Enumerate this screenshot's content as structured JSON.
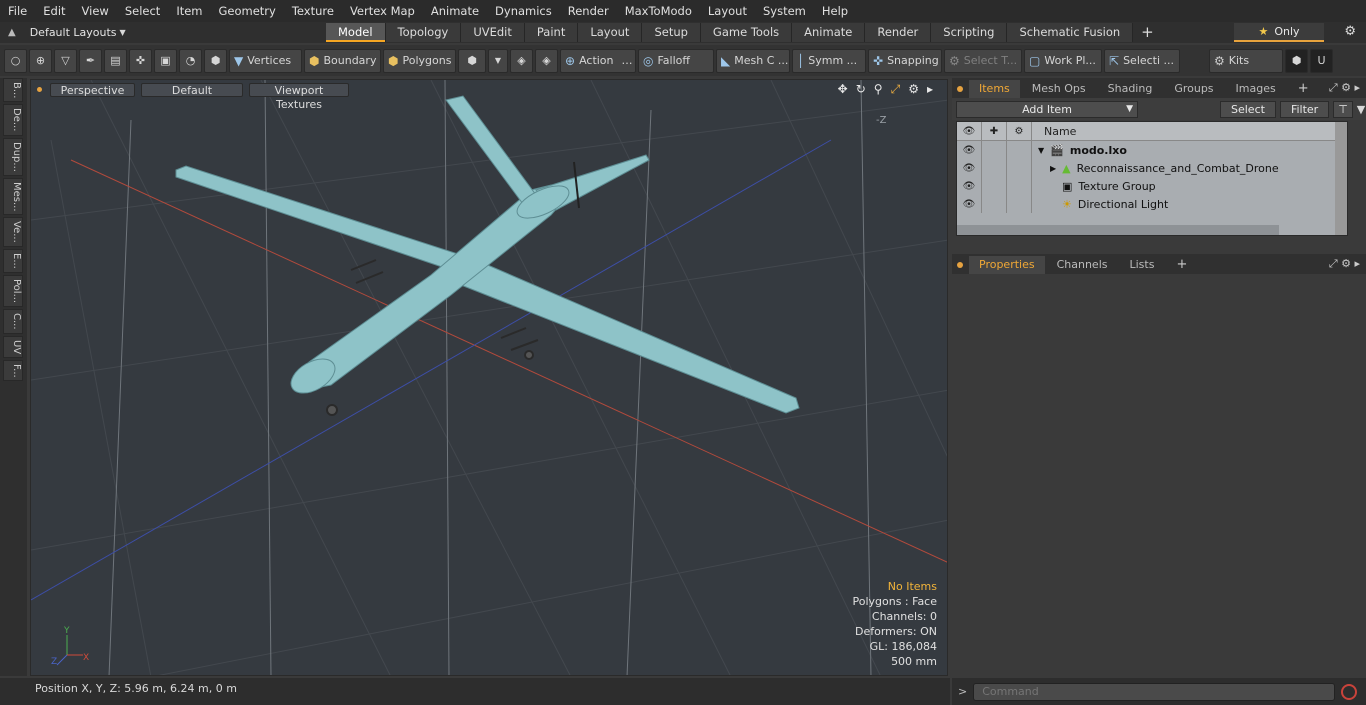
{
  "menu": [
    "File",
    "Edit",
    "View",
    "Select",
    "Item",
    "Geometry",
    "Texture",
    "Vertex Map",
    "Animate",
    "Dynamics",
    "Render",
    "MaxToModo",
    "Layout",
    "System",
    "Help"
  ],
  "layout": {
    "current": "Default Layouts",
    "tabs": [
      "Model",
      "Topology",
      "UVEdit",
      "Paint",
      "Layout",
      "Setup",
      "Game Tools",
      "Animate",
      "Render",
      "Scripting",
      "Schematic Fusion"
    ],
    "active_tab": "Model",
    "only_label": "Only"
  },
  "toolbar": {
    "vertices": "Vertices",
    "boundary": "Boundary",
    "polygons": "Polygons",
    "action": "Action",
    "falloff": "Falloff",
    "mesh": "Mesh C ...",
    "symmetry": "Symm ...",
    "snapping": "Snapping",
    "select_t": "Select T...",
    "work_plane": "Work Pl...",
    "selection": "Selecti ...",
    "kits": "Kits"
  },
  "left_tabs": [
    "B...",
    "De...",
    "Dup...",
    "Mes...",
    "Ve...",
    "E...",
    "Pol...",
    "C...",
    "UV",
    "F..."
  ],
  "viewport": {
    "view": "Perspective",
    "shading": "Default",
    "textures": "Viewport Textures",
    "axis_label": "-Z",
    "info": {
      "no_items": "No Items",
      "polygons": "Polygons : Face",
      "channels": "Channels: 0",
      "deformers": "Deformers: ON",
      "gl": "GL: 186,084",
      "scale": "500 mm"
    }
  },
  "items_panel": {
    "tabs": [
      "Items",
      "Mesh Ops",
      "Shading",
      "Groups",
      "Images"
    ],
    "active": "Items",
    "add_item": "Add Item",
    "select": "Select",
    "filter": "Filter",
    "name_header": "Name",
    "tree": [
      {
        "name": "modo.lxo",
        "bold": true
      },
      {
        "name": "Reconnaissance_and_Combat_Drone",
        "bold": false
      },
      {
        "name": "Texture Group",
        "bold": false
      },
      {
        "name": "Directional Light",
        "bold": false
      }
    ]
  },
  "props_panel": {
    "tabs": [
      "Properties",
      "Channels",
      "Lists"
    ],
    "active": "Properties"
  },
  "status": {
    "position": "Position X, Y, Z:   5.96 m, 6.24 m, 0 m"
  },
  "command": {
    "placeholder": "Command"
  }
}
